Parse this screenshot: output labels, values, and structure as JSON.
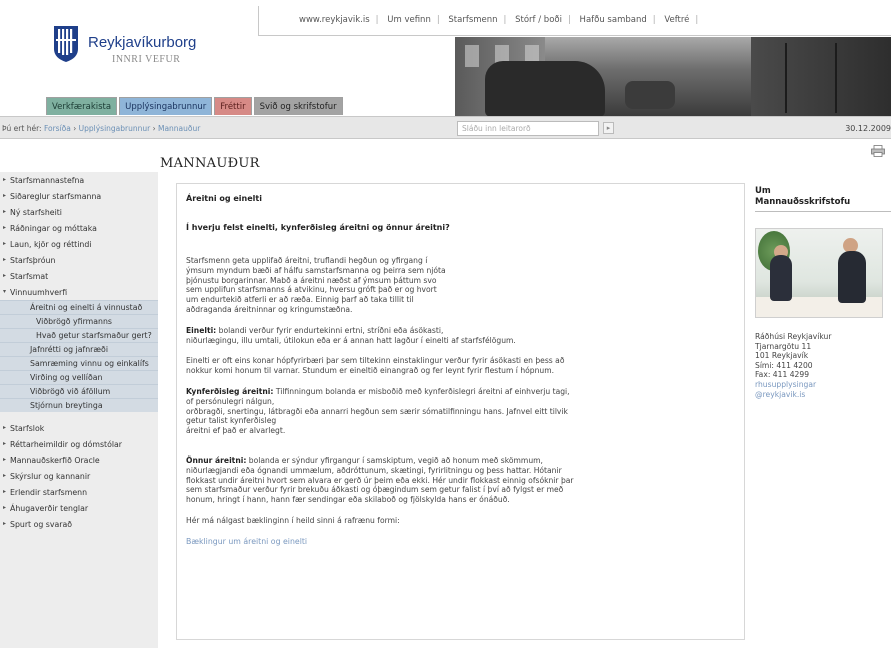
{
  "top_links": [
    "www.reykjavik.is",
    "Um vefinn",
    "Starfsmenn",
    "Stórf / boði",
    "Hafðu samband",
    "Veftré"
  ],
  "logo": {
    "name": "Reykjavíkurborg",
    "subtitle": "INNRI VEFUR"
  },
  "tabs": [
    "Verkfærakista",
    "Upplýsingabrunnur",
    "Fréttir",
    "Svið og skrifstofur"
  ],
  "breadcrumb": {
    "prefix": "Þú ert hér:",
    "items": [
      "Forsíða",
      "Upplýsingabrunnur",
      "Mannauður"
    ],
    "separator": " › "
  },
  "search": {
    "placeholder": "Sláðu inn leitarorð",
    "go_label": "▸"
  },
  "date": "30.12.2009",
  "page_title": "MANNAUÐUR",
  "nav": {
    "top_items": [
      "Starfsmannastefna",
      "Siðareglur starfsmanna",
      "Ný starfsheiti",
      "Ráðningar og móttaka",
      "Laun, kjör og réttindi",
      "Starfsþróun",
      "Starfsmat"
    ],
    "open_item": "Vinnuumhverfi",
    "sub_items": [
      "Áreitni og einelti á vinnustað",
      "Viðbrögð yfirmanns",
      "Hvað getur starfsmaður gert?",
      "Jafnrétti og jafnræði",
      "Samræming vinnu og einkalífs",
      "Virðing og vellíðan",
      "Viðbrögð við áföllum",
      "Stjórnun breytinga"
    ],
    "bottom_items": [
      "Starfslok",
      "Réttarheimildir og dómstólar",
      "Mannauðskerfið Oracle",
      "Skýrslur og kannanir",
      "Erlendir starfsmenn",
      "Áhugaverðir tenglar",
      "Spurt og svarað"
    ]
  },
  "content": {
    "heading": "Áreitni og einelti",
    "question": "Í hverju felst einelti, kynferðisleg áreitni og önnur áreitni?",
    "p1_lines": [
      "Starfsmenn geta upplifað áreitni, truflandi hegðun og yfirgang í",
      "ýmsum myndum bæði af hálfu samstarfsmanna og þeirra sem njóta",
      "þjónustu borgarinnar. Mabð a áreitni næðst af ýmsum þáttum svo",
      "sem upplifun starfsmanns á atvikinu, hversu gróft það er og hvort",
      "um endurtekið atferli er að ræða. Einnig þarf að taka tillit til",
      "aðdraganda áreitninnar og kringumstæðna."
    ],
    "einelti_term": "Einelti:",
    "einelti_lines": [
      "bolandi verður fyrir endurtekinni ertni, stríðni eða ásökasti,",
      "niðurlægingu, illu umtali, útilokun eða er á annan hatt lagður í einelti af starfsfélögum."
    ],
    "p3_lines": [
      "Einelti er oft eins konar hópfyrirbæri þar sem tiltekinn einstaklingur verður fyrir ásökasti en þess að",
      "nokkur komi honum til varnar. Stundum er eineltið einangrað og fer leynt fyrir flestum í hópnum."
    ],
    "kyn_term": "Kynferðisleg áreitni:",
    "kyn_lines": [
      "Tilfinningum bolanda er misboðið með kynferðislegri áreitni af einhverju tagi,",
      "of persónulegri nálgun,",
      "orðbragði, snertingu, látbragði eða annarri hegðun sem særir sómatilfinningu hans. Jafnvel eitt tilvik",
      "getur talist kynferðisleg",
      "áreitni ef það er alvarlegt."
    ],
    "onnur_term": "Önnur áreitni:",
    "onnur_lines": [
      "bolanda er sýndur yfirgangur í samskiptum, vegið að honum með skömmum,",
      "niðurlægjandi eða ógnandi ummælum, aðdróttunum, skætingi, fyrirlitningu og þess hattar. Hótanir",
      "flokkast undir áreitni hvort sem alvara er gerð úr þeim eða ekki. Hér undir flokkast einnig ofsóknir þar",
      "sem starfsmaður verður fyrir brekuðu áðkasti og óþægindum sem getur falist í því að fylgst er með",
      "honum, hringt í hann, hann fær sendingar eða skilaboð og fjölskylda hans er ónáðuð."
    ],
    "p6": "Hér má nálgast bæklinginn í heild sinni á rafrænu formi:",
    "link": "Bæklingur um áreitni og einelti"
  },
  "right": {
    "heading_lines": [
      "Um",
      "Mannauðsskrifstofu"
    ],
    "address_lines": [
      "Ráðhúsi Reykjavíkur",
      "Tjarnargötu 11",
      "101 Reykjavík",
      "Sími: 411 4200",
      "Fax: 411 4299"
    ],
    "email_lines": [
      "rhusupplysingar",
      "@reykjavik.is"
    ]
  },
  "colors": {
    "brand_blue": "#1f3f8a",
    "tab_green": "#7fb0a0",
    "tab_blue": "#8fb5d8",
    "tab_red": "#d68a86",
    "tab_grey": "#a3a3a3",
    "link": "#7a98bf",
    "nav_bg": "#ededed",
    "nav_sub_bg": "#d3dbe3"
  },
  "icons": {
    "logo": "city-shield-icon",
    "print": "printer-icon"
  }
}
